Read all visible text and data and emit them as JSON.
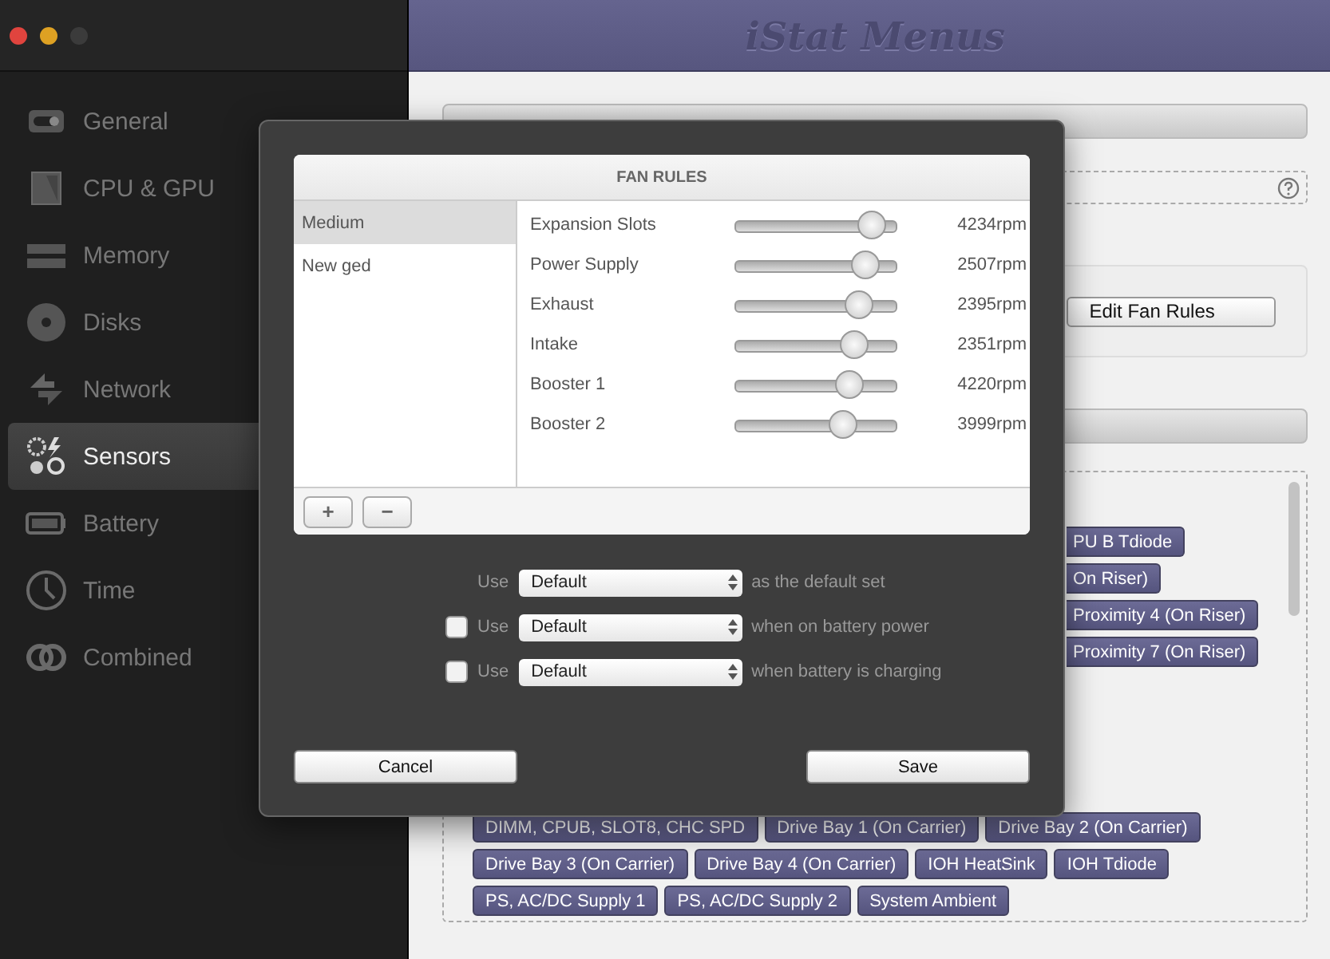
{
  "window": {
    "title": "iStat Menus"
  },
  "sidebar": {
    "items": [
      {
        "label": "General",
        "selected": false
      },
      {
        "label": "CPU & GPU",
        "selected": false
      },
      {
        "label": "Memory",
        "selected": false
      },
      {
        "label": "Disks",
        "selected": false
      },
      {
        "label": "Network",
        "selected": false
      },
      {
        "label": "Sensors",
        "selected": true
      },
      {
        "label": "Battery",
        "selected": false
      },
      {
        "label": "Time",
        "selected": false
      },
      {
        "label": "Combined",
        "selected": false
      }
    ]
  },
  "background": {
    "edit_button": "Edit Fan Rules",
    "partial_tags": [
      "PU B Tdiode",
      "On Riser)",
      "Proximity 4 (On Riser)",
      "Proximity 7 (On Riser)"
    ],
    "tags": [
      "DIMM, CPUB, SLOT8, CHC SPD",
      "Drive Bay 1 (On Carrier)",
      "Drive Bay 2 (On Carrier)",
      "Drive Bay 3 (On Carrier)",
      "Drive Bay 4 (On Carrier)",
      "IOH HeatSink",
      "IOH Tdiode",
      "PS, AC/DC Supply 1",
      "PS, AC/DC Supply 2",
      "System Ambient"
    ]
  },
  "dialog": {
    "title": "FAN RULES",
    "rules": [
      {
        "label": "Medium",
        "selected": true
      },
      {
        "label": "New ged",
        "selected": false
      }
    ],
    "fans": [
      {
        "name": "Expansion Slots",
        "level": 0.84,
        "reading": "4234rpm"
      },
      {
        "name": "Power Supply",
        "level": 0.8,
        "reading": "2507rpm"
      },
      {
        "name": "Exhaust",
        "level": 0.76,
        "reading": "2395rpm"
      },
      {
        "name": "Intake",
        "level": 0.74,
        "reading": "2351rpm"
      },
      {
        "name": "Booster 1",
        "level": 0.71,
        "reading": "4220rpm"
      },
      {
        "name": "Booster 2",
        "level": 0.67,
        "reading": "3999rpm"
      }
    ],
    "add_button": "+",
    "remove_button": "−",
    "use_rows": [
      {
        "kind": "plain",
        "label": "Use",
        "value": "Default",
        "suffix": "as the default set"
      },
      {
        "kind": "checkbox",
        "checked": false,
        "label": "Use",
        "value": "Default",
        "suffix": "when on battery power"
      },
      {
        "kind": "checkbox",
        "checked": false,
        "label": "Use",
        "value": "Default",
        "suffix": "when battery is charging"
      }
    ],
    "cancel": "Cancel",
    "save": "Save"
  }
}
